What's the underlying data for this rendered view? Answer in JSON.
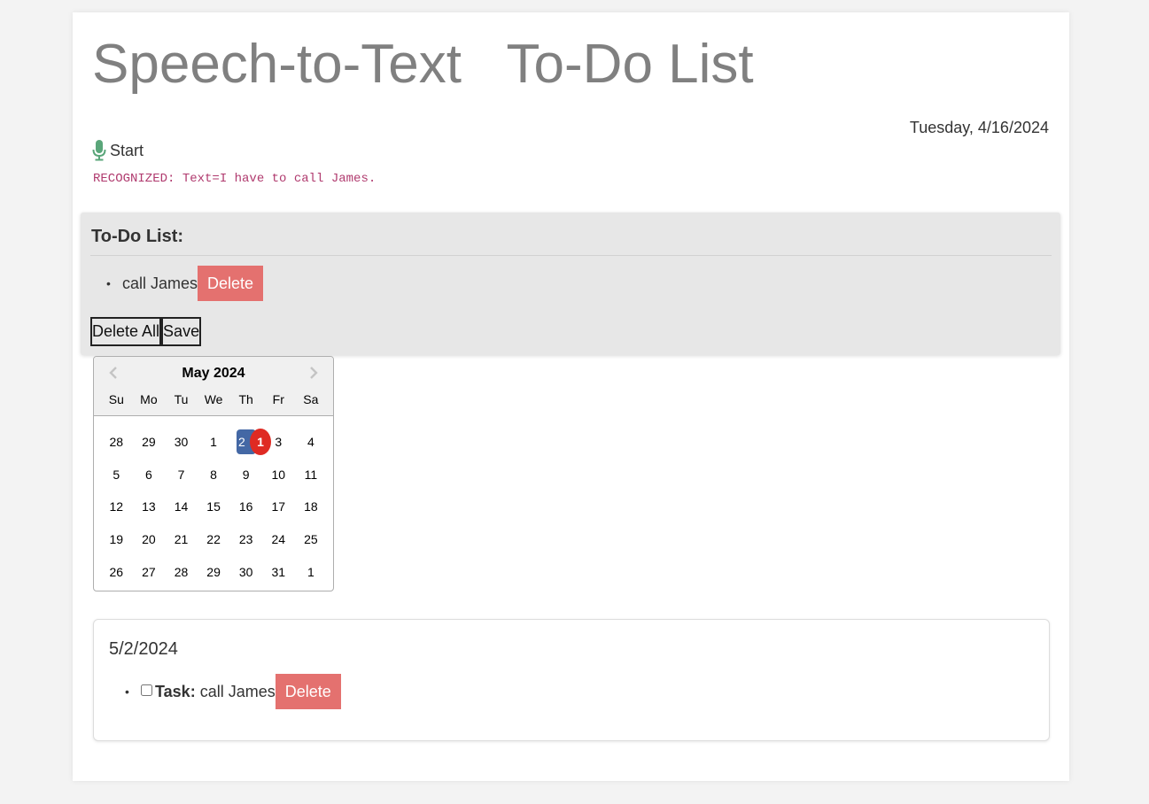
{
  "header": {
    "title": "Speech-to-Text   To-Do List",
    "date": "Tuesday, 4/16/2024"
  },
  "speech": {
    "start_label": "Start",
    "recognized_text": "RECOGNIZED: Text=I have to call James."
  },
  "todo": {
    "heading": "To-Do List:",
    "items": [
      {
        "text": "call James",
        "delete_label": "Delete"
      }
    ],
    "delete_all_label": "Delete All",
    "save_label": "Save"
  },
  "calendar": {
    "month_label": "May 2024",
    "weekdays": [
      "Su",
      "Mo",
      "Tu",
      "We",
      "Th",
      "Fr",
      "Sa"
    ],
    "weeks": [
      [
        "28",
        "29",
        "30",
        "1",
        "2",
        "3",
        "4"
      ],
      [
        "5",
        "6",
        "7",
        "8",
        "9",
        "10",
        "11"
      ],
      [
        "12",
        "13",
        "14",
        "15",
        "16",
        "17",
        "18"
      ],
      [
        "19",
        "20",
        "21",
        "22",
        "23",
        "24",
        "25"
      ],
      [
        "26",
        "27",
        "28",
        "29",
        "30",
        "31",
        "1"
      ]
    ],
    "selected_day": "2",
    "task_count_badge": "1",
    "colors": {
      "selected": "#4468a5",
      "badge": "#df2a23"
    }
  },
  "saved_tasks": {
    "date": "5/2/2024",
    "items": [
      {
        "label": "Task:",
        "text": "call James",
        "delete_label": "Delete",
        "checked": false
      }
    ]
  },
  "colors": {
    "delete_button": "#e4716f",
    "recognized_text": "#b03a6e",
    "mic_icon": "#5aa67a",
    "title": "#808080"
  },
  "icons": {
    "mic": "microphone-icon",
    "prev": "chevron-left-icon",
    "next": "chevron-right-icon"
  }
}
